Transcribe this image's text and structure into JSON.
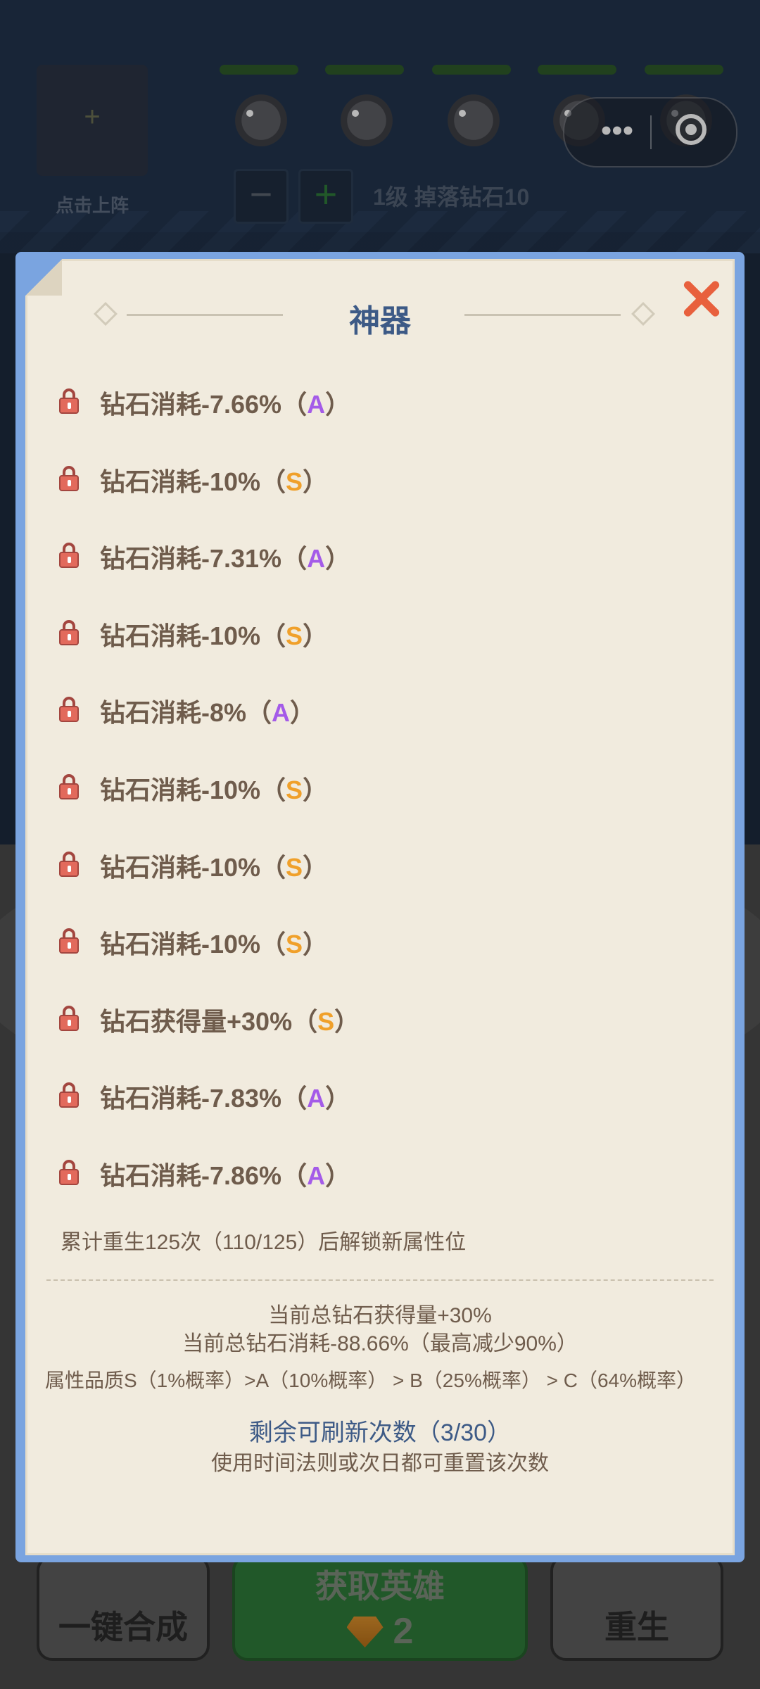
{
  "background": {
    "deploy_slot_plus": "+",
    "deploy_label": "点击上阵",
    "minus_label": "−",
    "plus_label": "+",
    "level_text": "1级 掉落钻石10",
    "capsule_dots": "•••"
  },
  "bottom_bar": {
    "merge_label": "一键合成",
    "get_hero_label": "获取英雄",
    "get_hero_cost": "2",
    "rebirth_label": "重生"
  },
  "modal": {
    "title": "神器",
    "attributes": [
      {
        "text": "钻石消耗-7.66%（",
        "grade": "A",
        "close": "）"
      },
      {
        "text": "钻石消耗-10%（",
        "grade": "S",
        "close": "）"
      },
      {
        "text": "钻石消耗-7.31%（",
        "grade": "A",
        "close": "）"
      },
      {
        "text": "钻石消耗-10%（",
        "grade": "S",
        "close": "）"
      },
      {
        "text": "钻石消耗-8%（",
        "grade": "A",
        "close": "）"
      },
      {
        "text": "钻石消耗-10%（",
        "grade": "S",
        "close": "）"
      },
      {
        "text": "钻石消耗-10%（",
        "grade": "S",
        "close": "）"
      },
      {
        "text": "钻石消耗-10%（",
        "grade": "S",
        "close": "）"
      },
      {
        "text": "钻石获得量+30%（",
        "grade": "S",
        "close": "）"
      },
      {
        "text": "钻石消耗-7.83%（",
        "grade": "A",
        "close": "）"
      },
      {
        "text": "钻石消耗-7.86%（",
        "grade": "A",
        "close": "）"
      }
    ],
    "unlock_hint": "累计重生125次（110/125）后解锁新属性位",
    "total_gain": "当前总钻石获得量+30%",
    "total_cost": "当前总钻石消耗-88.66%（最高减少90%）",
    "quality_info": "属性品质S（1%概率）>A（10%概率） > B（25%概率） > C（64%概率）",
    "refresh_count": "剩余可刷新次数（3/30）",
    "reset_hint": "使用时间法则或次日都可重置该次数"
  },
  "colors": {
    "grade_a": "#a45be8",
    "grade_s": "#f0a02a",
    "title": "#3d5a86",
    "close": "#e8603d",
    "frame": "#7aa4e0"
  }
}
